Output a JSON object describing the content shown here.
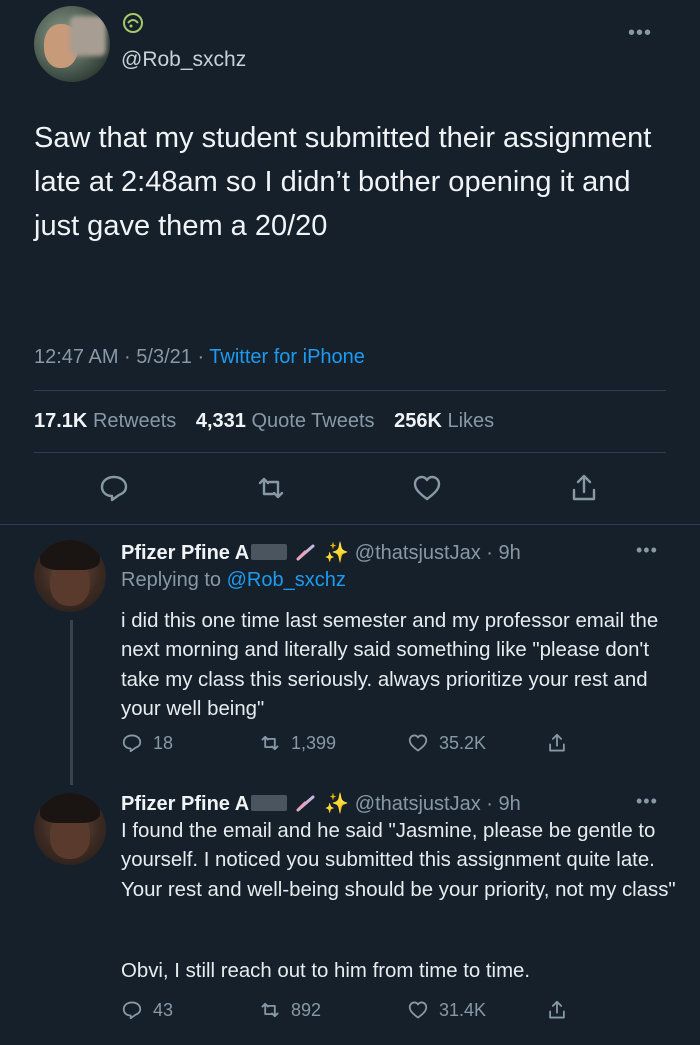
{
  "tweet": {
    "handle": "@Rob_sxchz",
    "text": "Saw that my student submitted their assignment late at 2:48am so I didn’t bother opening it and just gave them a 20/20",
    "time": "12:47 AM · 5/3/21 · ",
    "client": "Twitter for iPhone",
    "stats": {
      "retweets_count": "17.1K",
      "retweets_label": "Retweets",
      "quotes_count": "4,331",
      "quotes_label": "Quote Tweets",
      "likes_count": "256K",
      "likes_label": "Likes"
    }
  },
  "replies": [
    {
      "name": "Pfizer Pfine A",
      "handle": "@thatsjustJax",
      "age": "· 9h",
      "replying_prefix": "Replying to ",
      "replying_to": "@Rob_sxchz",
      "text": "i did this one time last semester and my professor email the next morning and literally said something like \"please don't take my class this seriously. always prioritize your rest and your well being\"",
      "replies": "18",
      "retweets": "1,399",
      "likes": "35.2K"
    },
    {
      "name": "Pfizer Pfine A",
      "handle": "@thatsjustJax",
      "age": "· 9h",
      "text1": "I found the email and he said \"Jasmine, please be gentle to yourself. I noticed you submitted this assignment quite late. Your rest and well-being should be your priority, not my class\"",
      "text2": "Obvi, I still reach out to him from time to time.",
      "replies": "43",
      "retweets": "892",
      "likes": "31.4K"
    }
  ],
  "icons": [
    "reply-icon",
    "retweet-icon",
    "like-icon",
    "share-icon",
    "more-icon",
    "sparkles-icon",
    "rocket-icon"
  ],
  "colors": {
    "background": "#15202b",
    "accent": "#1d9bf0",
    "muted": "#8899a6"
  }
}
